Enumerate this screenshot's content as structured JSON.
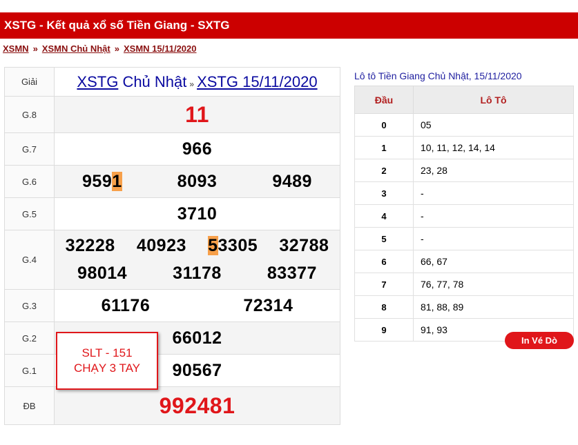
{
  "header": {
    "title": "XSTG - Kết quả xổ số Tiền Giang - SXTG"
  },
  "breadcrumb": [
    {
      "label": "XSMN"
    },
    {
      "label": "XSMN Chủ Nhật"
    },
    {
      "label": "XSMN 15/11/2020"
    }
  ],
  "breadcrumb_sep": "»",
  "results": {
    "col_label": "Giải",
    "head_link1": "XSTG",
    "head_day": "Chủ Nhật",
    "head_sep": "»",
    "head_link2": "XSTG 15/11/2020",
    "g8": {
      "label": "G.8",
      "value": "11"
    },
    "g7": {
      "label": "G.7",
      "value": "966"
    },
    "g6": {
      "label": "G.6",
      "v1_a": "959",
      "v1_b": "1",
      "v2": "8093",
      "v3": "9489"
    },
    "g5": {
      "label": "G.5",
      "value": "3710"
    },
    "g4": {
      "label": "G.4",
      "v1": "32228",
      "v2": "40923",
      "v3_a": "5",
      "v3_b": "3305",
      "v4": "32788",
      "v5": "98014",
      "v6": "31178",
      "v7": "83377"
    },
    "g3": {
      "label": "G.3",
      "v1": "61176",
      "v2": "72314"
    },
    "g2": {
      "label": "G.2",
      "value": "66012"
    },
    "g1": {
      "label": "G.1",
      "value": "90567"
    },
    "db": {
      "label": "ĐB",
      "value": "992481"
    }
  },
  "note": {
    "line1": "SLT - 151",
    "line2": "CHẠY 3 TAY"
  },
  "loto": {
    "title": "Lô tô Tiền Giang Chủ Nhật, 15/11/2020",
    "head_dau": "Đầu",
    "head_loto": "Lô Tô",
    "rows": [
      {
        "dau": "0",
        "loto": "05"
      },
      {
        "dau": "1",
        "loto": "10, 11, 12, 14, 14"
      },
      {
        "dau": "2",
        "loto": "23, 28"
      },
      {
        "dau": "3",
        "loto": "-"
      },
      {
        "dau": "4",
        "loto": "-"
      },
      {
        "dau": "5",
        "loto": "-"
      },
      {
        "dau": "6",
        "loto": "66, 67"
      },
      {
        "dau": "7",
        "loto": "76, 77, 78"
      },
      {
        "dau": "8",
        "loto": "81, 88, 89"
      },
      {
        "dau": "9",
        "loto": "91, 93"
      }
    ]
  },
  "print_button": {
    "label": "In Vé Dò"
  },
  "colors": {
    "brand_red": "#cc0000",
    "number_red": "#e0161a",
    "highlight": "#f7a04a",
    "link_blue": "#0a0aa0"
  }
}
